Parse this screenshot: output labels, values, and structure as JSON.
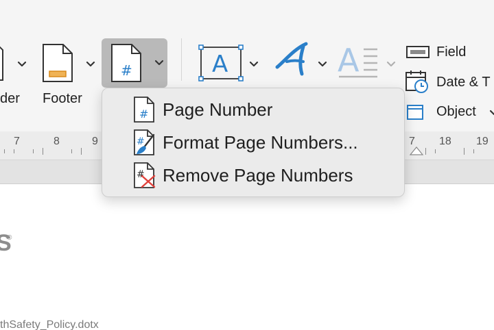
{
  "ribbon": {
    "header_label": "der",
    "footer_label": "Footer",
    "field_label": "Field",
    "date_label": "Date & T",
    "object_label": "Object"
  },
  "icons": {
    "header": "header-icon",
    "footer": "footer-icon",
    "page_number": "page-number-icon",
    "text_box": "text-box-icon",
    "wordart": "wordart-icon",
    "drop_cap": "drop-cap-icon",
    "field": "field-icon",
    "date_time": "date-time-icon",
    "object": "object-icon",
    "chevron": "chevron-down-icon"
  },
  "ruler": {
    "left_numbers": [
      "7",
      "8",
      "9"
    ],
    "right_numbers": [
      "7",
      "18",
      "19"
    ]
  },
  "menu": {
    "items": [
      {
        "label": "Page Number"
      },
      {
        "label": "Format Page Numbers..."
      },
      {
        "label": "Remove Page Numbers"
      }
    ]
  },
  "document": {
    "logo_fragment": "S",
    "logo_registered": "®",
    "footer_text": "thSafety_Policy.dotx"
  },
  "colors": {
    "accent_blue": "#2a7fc9",
    "remove_red": "#e0413b",
    "footer_orange": "#f0b356",
    "pressed_button": "#b9b9b9",
    "drop_cap_disabled": "#a9c7e6"
  }
}
